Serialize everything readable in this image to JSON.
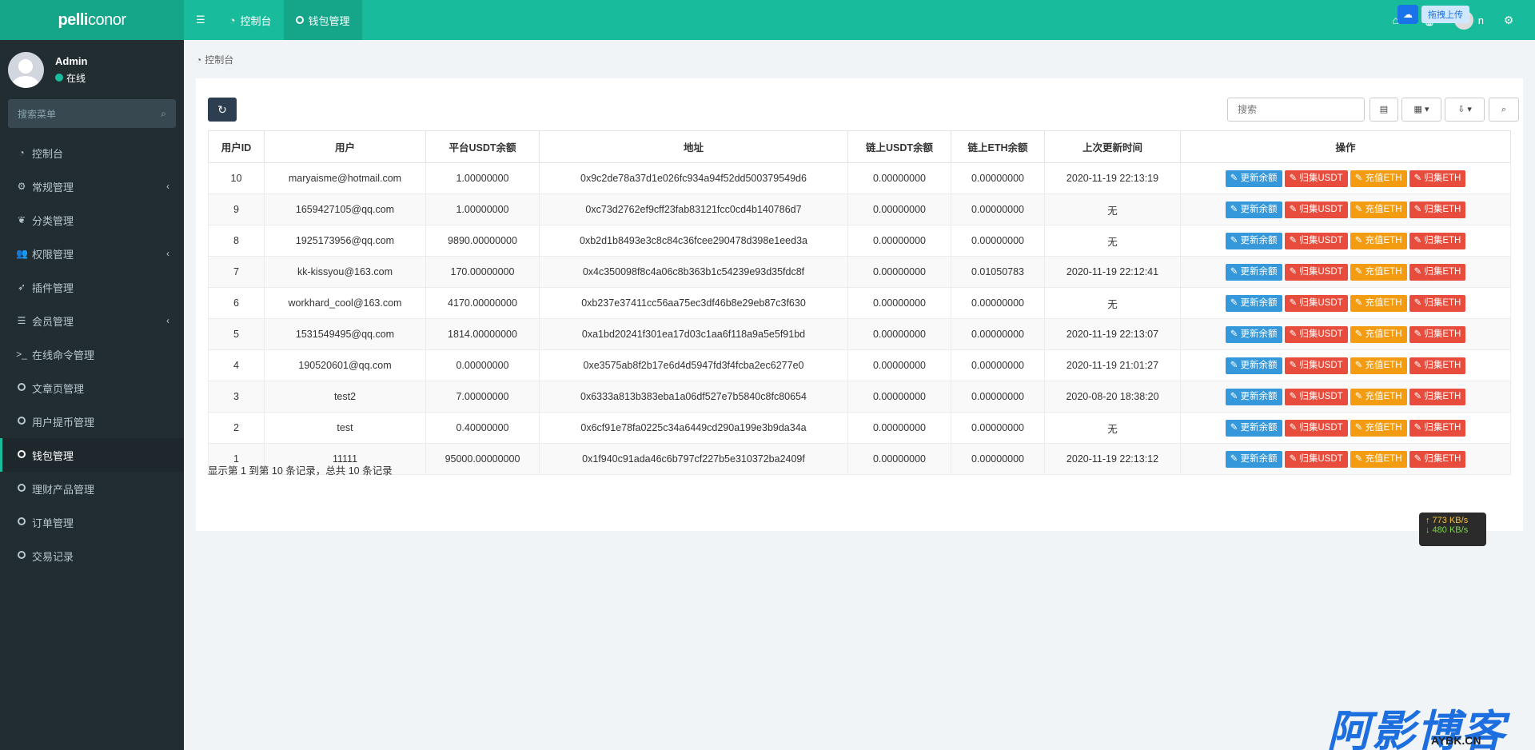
{
  "header": {
    "logo_bold": "pelli",
    "logo_rest": "conor",
    "nav": [
      {
        "label": "控制台",
        "icon": "dashboard-icon"
      },
      {
        "label": "钱包管理",
        "icon": "circle-icon"
      }
    ],
    "upload_label": "拖拽上传",
    "user_short": "n"
  },
  "sidebar": {
    "user": {
      "name": "Admin",
      "status": "在线"
    },
    "search_placeholder": "搜索菜单",
    "items": [
      {
        "label": "控制台",
        "icon": "dashboard-icon"
      },
      {
        "label": "常规管理",
        "icon": "cogs-icon"
      },
      {
        "label": "分类管理",
        "icon": "leaf-icon"
      },
      {
        "label": "权限管理",
        "icon": "group-icon"
      },
      {
        "label": "插件管理",
        "icon": "rocket-icon"
      },
      {
        "label": "会员管理",
        "icon": "list-icon"
      },
      {
        "label": "在线命令管理",
        "icon": "terminal-icon"
      },
      {
        "label": "文章页管理",
        "icon": "circle-icon"
      },
      {
        "label": "用户提币管理",
        "icon": "circle-icon"
      },
      {
        "label": "钱包管理",
        "icon": "circle-icon"
      },
      {
        "label": "理财产品管理",
        "icon": "circle-icon"
      },
      {
        "label": "订单管理",
        "icon": "circle-icon"
      },
      {
        "label": "交易记录",
        "icon": "circle-icon"
      }
    ]
  },
  "breadcrumb": "控制台",
  "toolbar": {
    "search_placeholder": "搜索"
  },
  "table": {
    "headers": [
      "用户ID",
      "用户",
      "平台USDT余额",
      "地址",
      "链上USDT余额",
      "链上ETH余额",
      "上次更新时间",
      "操作"
    ],
    "actions": [
      "更新余额",
      "归集USDT",
      "充值ETH",
      "归集ETH"
    ],
    "rows": [
      [
        "10",
        "maryaisme@hotmail.com",
        "1.00000000",
        "0x9c2de78a37d1e026fc934a94f52dd500379549d6",
        "0.00000000",
        "0.00000000",
        "2020-11-19 22:13:19"
      ],
      [
        "9",
        "1659427105@qq.com",
        "1.00000000",
        "0xc73d2762ef9cff23fab83121fcc0cd4b140786d7",
        "0.00000000",
        "0.00000000",
        "无"
      ],
      [
        "8",
        "1925173956@qq.com",
        "9890.00000000",
        "0xb2d1b8493e3c8c84c36fcee290478d398e1eed3a",
        "0.00000000",
        "0.00000000",
        "无"
      ],
      [
        "7",
        "kk-kissyou@163.com",
        "170.00000000",
        "0x4c350098f8c4a06c8b363b1c54239e93d35fdc8f",
        "0.00000000",
        "0.01050783",
        "2020-11-19 22:12:41"
      ],
      [
        "6",
        "workhard_cool@163.com",
        "4170.00000000",
        "0xb237e37411cc56aa75ec3df46b8e29eb87c3f630",
        "0.00000000",
        "0.00000000",
        "无"
      ],
      [
        "5",
        "1531549495@qq.com",
        "1814.00000000",
        "0xa1bd20241f301ea17d03c1aa6f118a9a5e5f91bd",
        "0.00000000",
        "0.00000000",
        "2020-11-19 22:13:07"
      ],
      [
        "4",
        "190520601@qq.com",
        "0.00000000",
        "0xe3575ab8f2b17e6d4d5947fd3f4fcba2ec6277e0",
        "0.00000000",
        "0.00000000",
        "2020-11-19 21:01:27"
      ],
      [
        "3",
        "test2",
        "7.00000000",
        "0x6333a813b383eba1a06df527e7b5840c8fc80654",
        "0.00000000",
        "0.00000000",
        "2020-08-20 18:38:20"
      ],
      [
        "2",
        "test",
        "0.40000000",
        "0x6cf91e78fa0225c34a6449cd290a199e3b9da34a",
        "0.00000000",
        "0.00000000",
        "无"
      ],
      [
        "1",
        "11111",
        "95000.00000000",
        "0x1f940c91ada46c6b797cf227b5e310372ba2409f",
        "0.00000000",
        "0.00000000",
        "2020-11-19 22:13:12"
      ]
    ]
  },
  "pager": "显示第 1 到第 10 条记录，总共 10 条记录",
  "speed": {
    "up": "↑ 773 KB/s",
    "down": "↓ 480 KB/s"
  },
  "watermark": {
    "main": "阿影博客",
    "sub": "AYBK.CN"
  },
  "colors": {
    "brand": "#18bc9c",
    "sidebar": "#222d32",
    "blue": "#3498db",
    "red": "#e74c3c",
    "orange": "#f39c12"
  }
}
